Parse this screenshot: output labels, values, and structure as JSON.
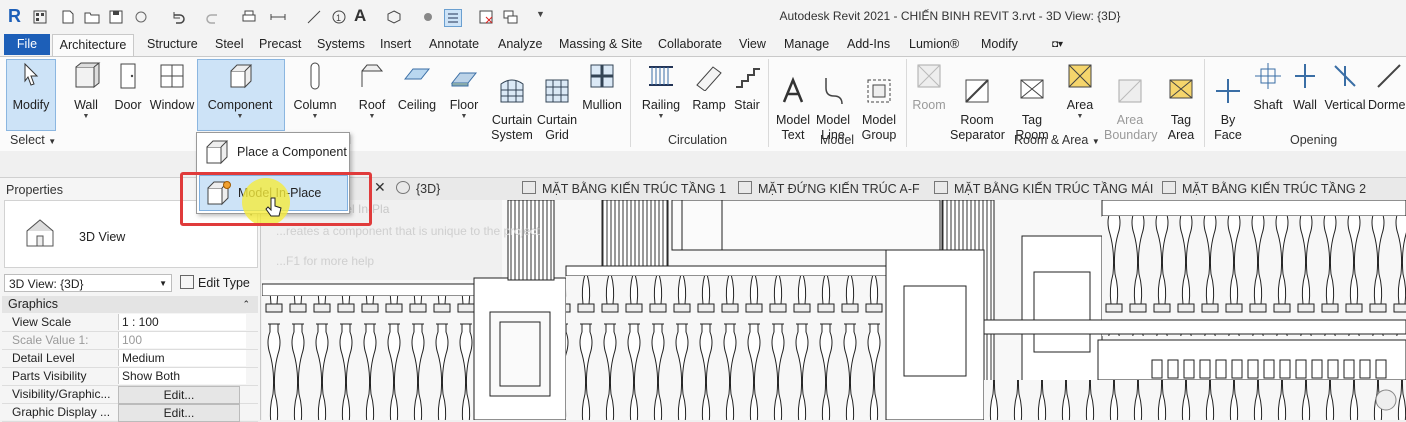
{
  "window": {
    "title": "Autodesk Revit 2021 - CHIẾN BINH REVIT 3.rvt - 3D View: {3D}"
  },
  "tabs": [
    "File",
    "Architecture",
    "Structure",
    "Steel",
    "Precast",
    "Systems",
    "Insert",
    "Annotate",
    "Analyze",
    "Massing & Site",
    "Collaborate",
    "View",
    "Manage",
    "Add-Ins",
    "Lumion®",
    "Modify"
  ],
  "ribbon": {
    "buttons": [
      "Modify",
      "Wall",
      "Door",
      "Window",
      "Component",
      "Column",
      "Roof",
      "Ceiling",
      "Floor",
      "Curtain\nSystem",
      "Curtain\nGrid",
      "Mullion",
      "Railing",
      "Ramp",
      "Stair",
      "Model\nText",
      "Model\nLine",
      "Model\nGroup",
      "Room",
      "Room\nSeparator",
      "Tag\nRoom",
      "Area",
      "Area\nBoundary",
      "Tag\nArea",
      "By\nFace",
      "Shaft",
      "Wall",
      "Vertical",
      "Dorme"
    ],
    "panels": [
      "Select",
      "d",
      "Circulation",
      "Model",
      "Room & Area",
      "Opening"
    ]
  },
  "dropdown": {
    "items": [
      "Place a Component",
      "Model In-Place"
    ]
  },
  "tooltip": {
    "line1": "Model In-Pla",
    "line2": "...reates a component that is unique to the project",
    "line3": "...F1 for more help"
  },
  "view_tabs": [
    "{3D}",
    "MẶT BẰNG KIẾN TRÚC TẦNG 1",
    "MẶT ĐỨNG KIẾN TRÚC A-F",
    "MẶT BẰNG KIẾN TRÚC TẦNG MÁI",
    "MẶT BẰNG KIẾN TRÚC TẦNG 2"
  ],
  "properties": {
    "header": "Properties",
    "type_name": "3D View",
    "selector": "3D View: {3D}",
    "edit_type": "Edit Type",
    "group": "Graphics",
    "rows": [
      {
        "key": "View Scale",
        "value": "1 : 100"
      },
      {
        "key": "Scale Value    1:",
        "value": "100"
      },
      {
        "key": "Detail Level",
        "value": "Medium"
      },
      {
        "key": "Parts Visibility",
        "value": "Show Both"
      },
      {
        "key": "Visibility/Graphic...",
        "value": "Edit..."
      },
      {
        "key": "Graphic Display ...",
        "value": "Edit..."
      }
    ]
  },
  "colors": {
    "file_tab": "#1d5fb8",
    "highlight": "#cde3f7",
    "callout": "#e03b3b",
    "cursor_halo": "#f5eb3c"
  },
  "icons": [
    "revit-logo-icon",
    "house-3d-icon",
    "close-icon",
    "cursor-icon"
  ]
}
